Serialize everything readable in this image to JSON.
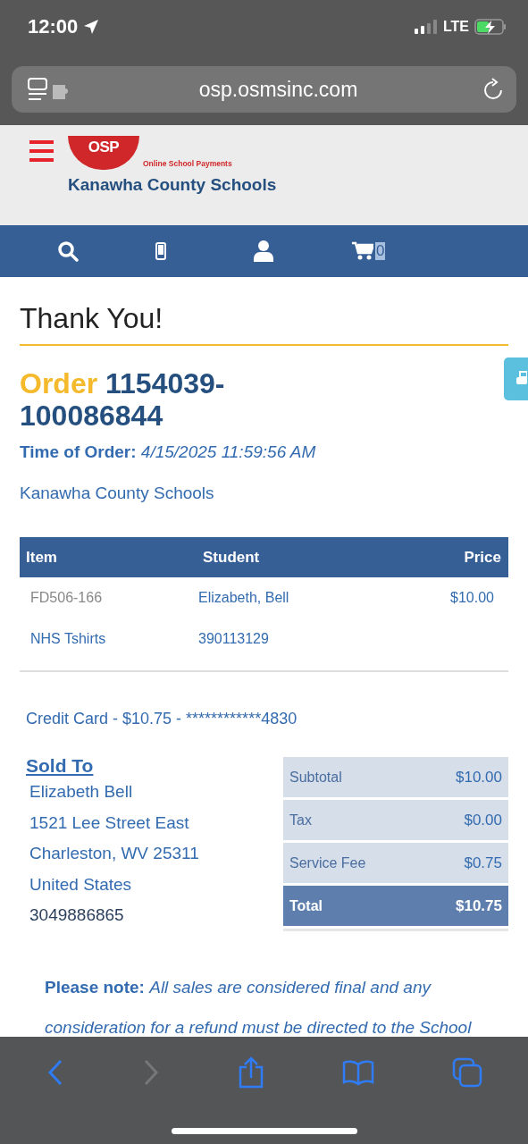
{
  "status_bar": {
    "time": "12:00",
    "network": "LTE"
  },
  "browser": {
    "url": "osp.osmsinc.com"
  },
  "site_header": {
    "logo_text": "OSP",
    "tagline": "Online School Payments",
    "district": "Kanawha County Schools"
  },
  "nav": {
    "cart_count": "0"
  },
  "page": {
    "title": "Thank You!",
    "order_label": "Order",
    "order_number": "1154039-100086844",
    "time_label": "Time of Order:",
    "time_value": "4/15/2025 11:59:56 AM",
    "district": "Kanawha County Schools"
  },
  "order_table": {
    "columns": [
      "Item",
      "Student",
      "Price"
    ],
    "rows": [
      {
        "code": "FD506-166",
        "name": "NHS Tshirts",
        "student": "Elizabeth, Bell",
        "student_id": "390113129",
        "price": "$10.00"
      }
    ]
  },
  "payment": "Credit Card - $10.75 - ************4830",
  "sold_to": {
    "heading": "Sold To",
    "lines": [
      "Elizabeth Bell",
      "1521 Lee Street East",
      "Charleston, WV 25311",
      "United States"
    ],
    "phone": "3049886865"
  },
  "summary": [
    {
      "label": "Subtotal",
      "value": "$10.00",
      "kind": "line"
    },
    {
      "label": "Tax",
      "value": "$0.00",
      "kind": "line"
    },
    {
      "label": "Service Fee",
      "value": "$0.75",
      "kind": "line"
    },
    {
      "label": "Total",
      "value": "$10.75",
      "kind": "total"
    }
  ],
  "note": "**Please note:** *All sales are considered final and any consideration for a refund must be directed to the School*",
  "toolbar": {
    "back_disabled": false,
    "forward_disabled": true
  }
}
